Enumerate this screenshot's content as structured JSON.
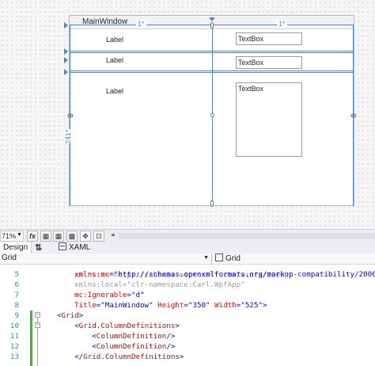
{
  "designer": {
    "window_title": "MainWindow",
    "column_marker_1": "1*",
    "column_marker_2": "1*",
    "row_marker": "241*",
    "labels": [
      "Label",
      "Label",
      "Label"
    ],
    "textboxes": [
      "TextBox",
      "TextBox",
      "TextBox"
    ]
  },
  "toolbar": {
    "zoom": "71%",
    "fx_label": "fx"
  },
  "tabs": {
    "design": "Design",
    "swap": "⇅",
    "xaml": "XAML"
  },
  "navbar": {
    "left": "Grid",
    "right": "Grid"
  },
  "editor": {
    "lines": [
      {
        "n": "5",
        "parts": [
          [
            "t-attr",
            "xmlns:mc"
          ],
          [
            "t-punc",
            "="
          ],
          [
            "t-val",
            "\"http://schemas.openxmlformats.org/markup-compatibility/2006\""
          ]
        ]
      },
      {
        "n": "6",
        "parts": [
          [
            "t-gray",
            "xmlns:local=\"clr-namespace:Carl.WpfApp\""
          ]
        ]
      },
      {
        "n": "7",
        "parts": [
          [
            "t-attr",
            "mc:Ignorable"
          ],
          [
            "t-punc",
            "="
          ],
          [
            "t-val",
            "\"d\""
          ]
        ]
      },
      {
        "n": "8",
        "parts": [
          [
            "t-attr",
            "Title"
          ],
          [
            "t-punc",
            "="
          ],
          [
            "t-val",
            "\"MainWindow\""
          ],
          [
            "t-punc",
            " "
          ],
          [
            "t-attr",
            "Height"
          ],
          [
            "t-punc",
            "="
          ],
          [
            "t-val",
            "\"350\""
          ],
          [
            "t-punc",
            " "
          ],
          [
            "t-attr",
            "Width"
          ],
          [
            "t-punc",
            "="
          ],
          [
            "t-val",
            "\"525\""
          ],
          [
            "t-punc",
            ">"
          ]
        ]
      },
      {
        "n": "9",
        "parts": [
          [
            "t-punc",
            "<"
          ],
          [
            "t-tag",
            "Grid"
          ],
          [
            "t-punc",
            ">"
          ]
        ]
      },
      {
        "n": "10",
        "parts": [
          [
            "t-punc",
            "    <"
          ],
          [
            "t-tag",
            "Grid.ColumnDefinitions"
          ],
          [
            "t-punc",
            ">"
          ]
        ]
      },
      {
        "n": "11",
        "parts": [
          [
            "t-punc",
            "        <"
          ],
          [
            "t-tag",
            "ColumnDefinition"
          ],
          [
            "t-punc",
            "/>"
          ]
        ]
      },
      {
        "n": "12",
        "parts": [
          [
            "t-punc",
            "        <"
          ],
          [
            "t-tag",
            "ColumnDefinition"
          ],
          [
            "t-punc",
            "/>"
          ]
        ]
      },
      {
        "n": "13",
        "parts": [
          [
            "t-punc",
            "    </"
          ],
          [
            "t-tag",
            "Grid.ColumnDefinitions"
          ],
          [
            "t-punc",
            ">"
          ]
        ]
      }
    ]
  }
}
